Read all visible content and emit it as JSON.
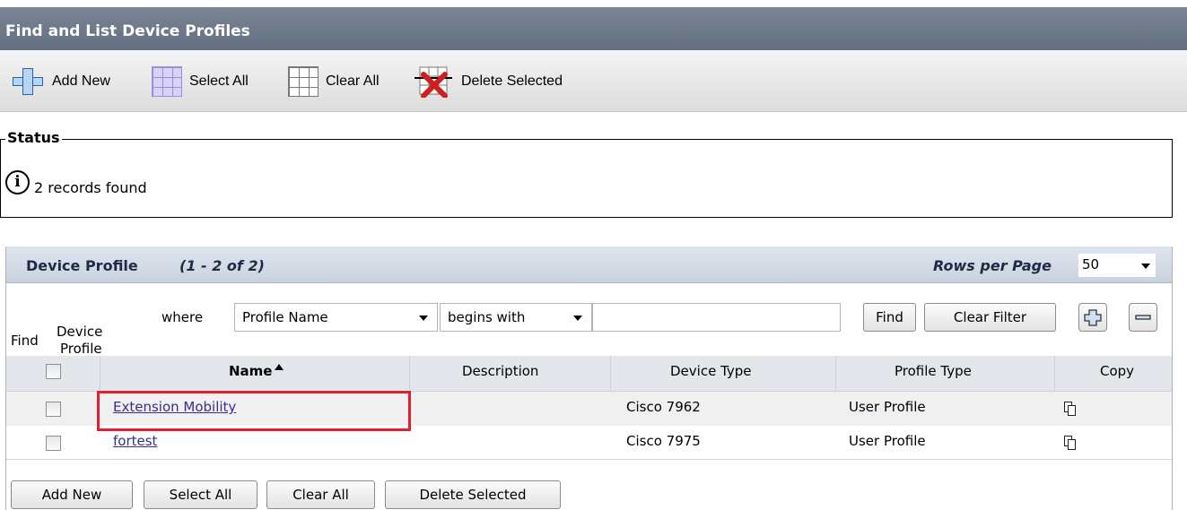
{
  "page": {
    "title": "Find and List Device Profiles"
  },
  "toolbar": {
    "add_new": "Add New",
    "select_all": "Select All",
    "clear_all": "Clear All",
    "delete_selected": "Delete Selected"
  },
  "status": {
    "legend": "Status",
    "message": "2 records found"
  },
  "panel": {
    "title": "Device Profile",
    "range": "(1 - 2 of 2)",
    "rows_per_page_label": "Rows per Page",
    "rows_per_page_value": "50"
  },
  "find": {
    "find_label": "Find",
    "object_label_line1": "Device",
    "object_label_line2": "Profile",
    "where_label": "where",
    "field_value": "Profile Name",
    "operator_value": "begins with",
    "search_value": "",
    "find_button": "Find",
    "clear_filter_button": "Clear Filter"
  },
  "table": {
    "columns": [
      "Name",
      "Description",
      "Device Type",
      "Profile Type",
      "Copy"
    ],
    "sorted_column": "Name",
    "rows": [
      {
        "name": "Extension Mobility",
        "description": "",
        "device_type": "Cisco 7962",
        "profile_type": "User Profile"
      },
      {
        "name": "fortest",
        "description": "",
        "device_type": "Cisco 7975",
        "profile_type": "User Profile"
      }
    ]
  },
  "bottom_buttons": {
    "add_new": "Add New",
    "select_all": "Select All",
    "clear_all": "Clear All",
    "delete_selected": "Delete Selected"
  },
  "colors": {
    "title_bar": "#6b7588",
    "panel_header": "#d3dae5",
    "link": "#3b2c8c",
    "highlight": "#e0202e"
  }
}
